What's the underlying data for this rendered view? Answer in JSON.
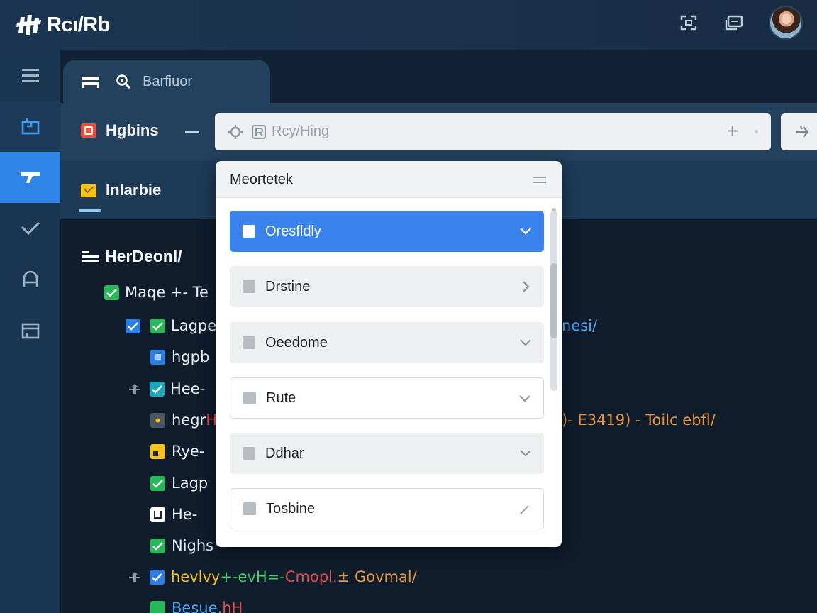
{
  "app": {
    "name": "Rcı/Rb"
  },
  "tab": {
    "label": "Barfiuor"
  },
  "project": {
    "title": "Hgbins"
  },
  "search": {
    "placeholder": "Rcy/Hing"
  },
  "section": {
    "title": "Inlarbie"
  },
  "tree": {
    "root_label": "HerDeonl/",
    "lines": [
      {
        "segments": [
          {
            "text": "Maqe +- Te",
            "color": "#4aa3f0"
          }
        ]
      },
      {
        "segments": [
          {
            "text": "Lagpe",
            "color": "#3fcf6a"
          }
        ],
        "trailing": "nesi/"
      },
      {
        "segments": [
          {
            "text": "hgpb",
            "color": "#3fcf6a"
          }
        ]
      },
      {
        "segments": [
          {
            "text": "Hee-",
            "color": "#3fcf6a"
          }
        ]
      },
      {
        "segments": [
          {
            "text": "hegr",
            "color": "#f2f4f7"
          },
          {
            "text": " H",
            "color": "#e44a4a"
          }
        ],
        "trailing": ")- E3419) - Toilc ebfl/"
      },
      {
        "segments": [
          {
            "text": "Rye-",
            "color": "#4aa3f0"
          }
        ]
      },
      {
        "segments": [
          {
            "text": "Lagp",
            "color": "#3fcf6a"
          }
        ]
      },
      {
        "segments": [
          {
            "text": "He-",
            "color": "#4aa3f0"
          }
        ]
      },
      {
        "segments": [
          {
            "text": "Nighs",
            "color": "#3fcf6a"
          }
        ]
      },
      {
        "segments": [
          {
            "text": "hevlvy",
            "color": "#f5c31b"
          },
          {
            "text": " +-evH=-",
            "color": "#3fcf6a"
          },
          {
            "text": "  Cmopl. ",
            "color": "#e44a4a"
          },
          {
            "text": "± Govmal/",
            "color": "#e8963a"
          }
        ]
      },
      {
        "segments": [
          {
            "text": "Besue. ",
            "color": "#4aa3f0"
          },
          {
            "text": "hH",
            "color": "#e44a4a"
          }
        ]
      }
    ]
  },
  "dropdown": {
    "title": "Meortetek",
    "items": [
      {
        "label": "Oresfldly",
        "state": "selected",
        "chevron": "down"
      },
      {
        "label": "Drstine",
        "state": "normal",
        "chevron": "right"
      },
      {
        "label": "Oeedome",
        "state": "normal",
        "chevron": "down"
      },
      {
        "label": "Rute",
        "state": "outline",
        "chevron": "down"
      },
      {
        "label": "Ddhar",
        "state": "normal",
        "chevron": "down"
      },
      {
        "label": "Tosbine",
        "state": "outline",
        "chevron": "edit"
      }
    ]
  },
  "colors": {
    "accent": "#3a82ec",
    "sidebar_active": "#2f86e6",
    "background": "#0f1c2c"
  },
  "icons": {
    "brand": "logo-icon",
    "top_actions": [
      "expand-icon",
      "window-icon"
    ],
    "sidebar": [
      "menu-icon",
      "board-icon",
      "tools-icon",
      "check-icon",
      "user-icon",
      "archive-icon"
    ]
  }
}
